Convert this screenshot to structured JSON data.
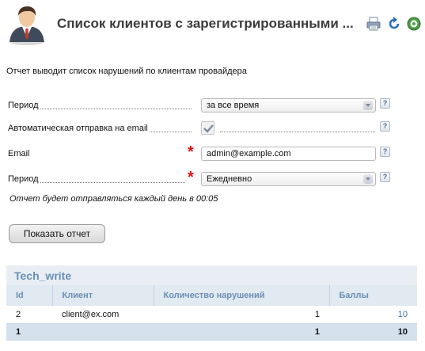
{
  "header": {
    "title": "Список клиентов с зарегистрированными ...",
    "icons": [
      "user-avatar-icon",
      "print-icon",
      "refresh-icon",
      "settings-icon"
    ]
  },
  "description": "Отчет выводит список нарушений по клиентам провайдера",
  "form": {
    "period": {
      "label": "Период",
      "value": "за все время"
    },
    "auto_send": {
      "label": "Автоматическая отправка на email",
      "checked": true
    },
    "email": {
      "label": "Email",
      "value": "admin@example.com",
      "required": "*"
    },
    "send_period": {
      "label": "Период",
      "value": "Ежедневно",
      "required": "*"
    },
    "help": "?"
  },
  "note": "Отчет будет отправляться каждый день в 00:05",
  "submit_label": "Показать отчет",
  "report": {
    "title": "Tech_write",
    "columns": [
      "Id",
      "Клиент",
      "Количество нарушений",
      "Баллы"
    ],
    "rows": [
      {
        "id": "2",
        "client": "client@ex.com",
        "violations": "1",
        "points": "10"
      }
    ],
    "total": {
      "id": "1",
      "client": "",
      "violations": "1",
      "points": "10"
    }
  },
  "colors": {
    "accent": "#6a8fb6",
    "required": "#e01010",
    "link": "#3a6ea5"
  }
}
